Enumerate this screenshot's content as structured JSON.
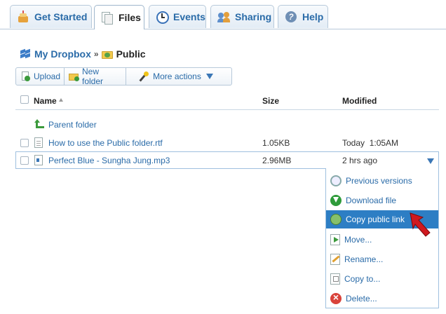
{
  "tabs": [
    {
      "label": "Get Started",
      "icon": "cake-icon"
    },
    {
      "label": "Files",
      "icon": "files-icon"
    },
    {
      "label": "Events",
      "icon": "clock-icon"
    },
    {
      "label": "Sharing",
      "icon": "people-icon"
    },
    {
      "label": "Help",
      "icon": "help-icon"
    }
  ],
  "active_tab": "Files",
  "breadcrumb": {
    "root": "My Dropbox",
    "separator": "»",
    "current": "Public"
  },
  "toolbar": {
    "upload": "Upload",
    "new_folder": "New folder",
    "more_actions": "More actions"
  },
  "table": {
    "headers": {
      "name": "Name",
      "size": "Size",
      "modified": "Modified"
    },
    "parent_label": "Parent folder",
    "rows": [
      {
        "name": "How to use the Public folder.rtf",
        "size": "1.05KB",
        "modified": "Today  1:05AM",
        "icon": "document-icon"
      },
      {
        "name": "Perfect Blue - Sungha Jung.mp3",
        "size": "2.96MB",
        "modified": "2 hrs ago",
        "icon": "audio-file-icon"
      }
    ]
  },
  "context_menu": {
    "items": [
      {
        "label": "Previous versions",
        "icon": "previous-versions-icon"
      },
      {
        "label": "Download file",
        "icon": "download-icon"
      },
      {
        "label": "Copy public link",
        "icon": "link-icon"
      },
      {
        "label": "Move...",
        "icon": "move-icon"
      },
      {
        "label": "Rename...",
        "icon": "rename-icon"
      },
      {
        "label": "Copy to...",
        "icon": "copy-icon"
      },
      {
        "label": "Delete...",
        "icon": "delete-icon"
      }
    ],
    "highlighted": "Copy public link"
  },
  "colors": {
    "link": "#2a6ba8",
    "highlight": "#2d7ec4",
    "border": "#b7c9da",
    "pointer_arrow": "#d0191f"
  }
}
